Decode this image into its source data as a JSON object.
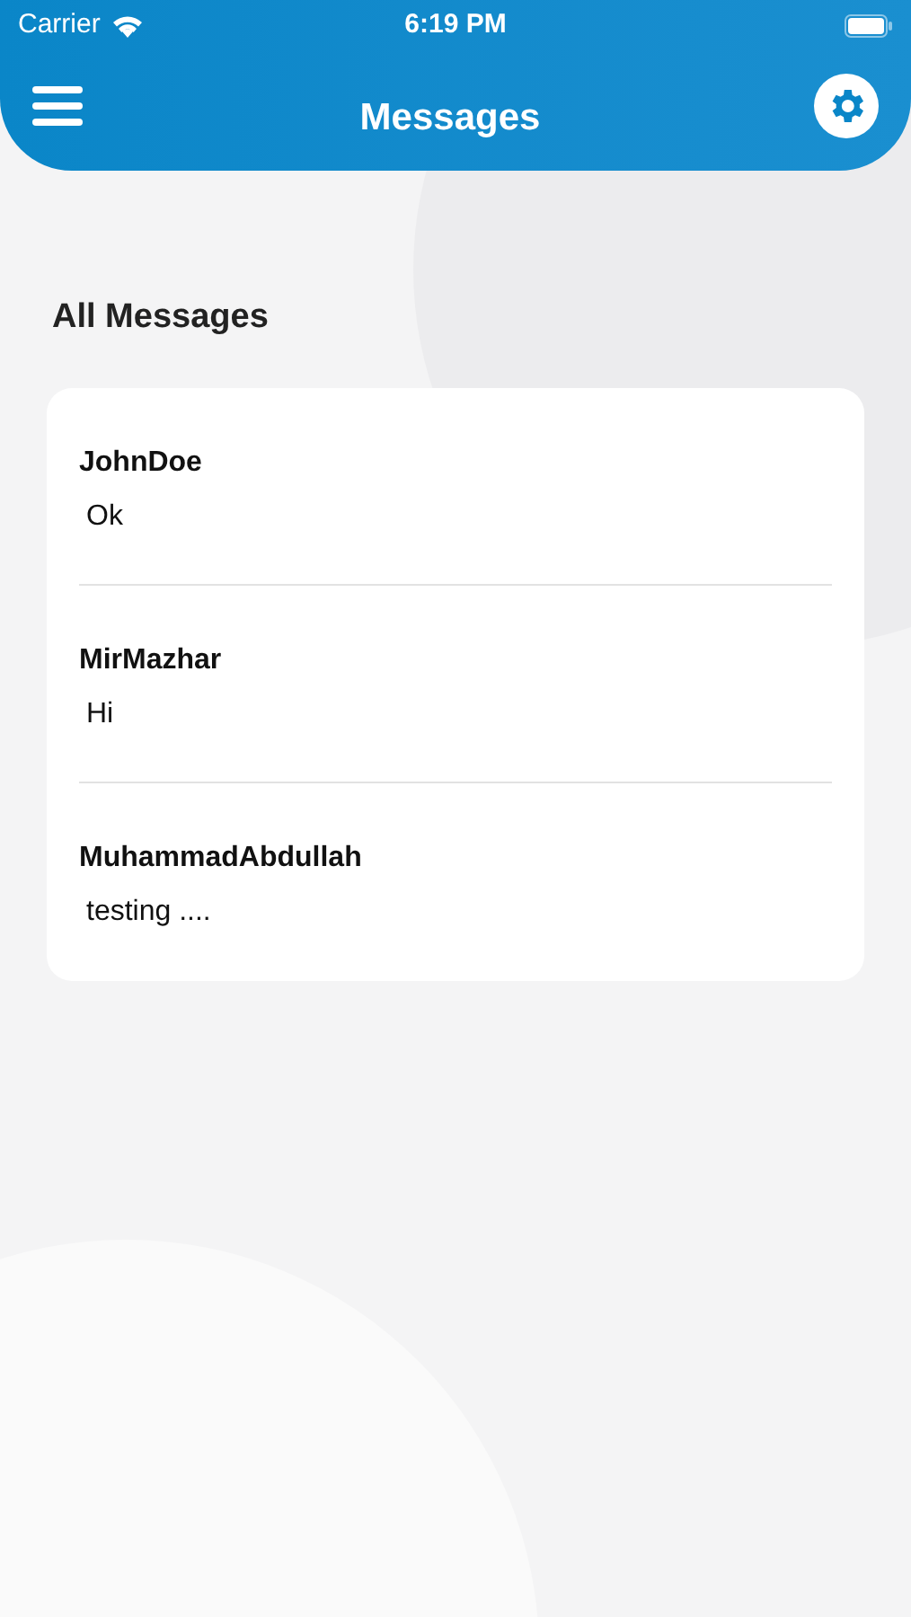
{
  "status_bar": {
    "carrier": "Carrier",
    "time": "6:19 PM"
  },
  "header": {
    "title": "Messages"
  },
  "section_title": "All Messages",
  "messages": [
    {
      "name": "JohnDoe",
      "text": "Ok"
    },
    {
      "name": "MirMazhar",
      "text": "Hi"
    },
    {
      "name": "MuhammadAbdullah",
      "text": "testing ...."
    }
  ]
}
